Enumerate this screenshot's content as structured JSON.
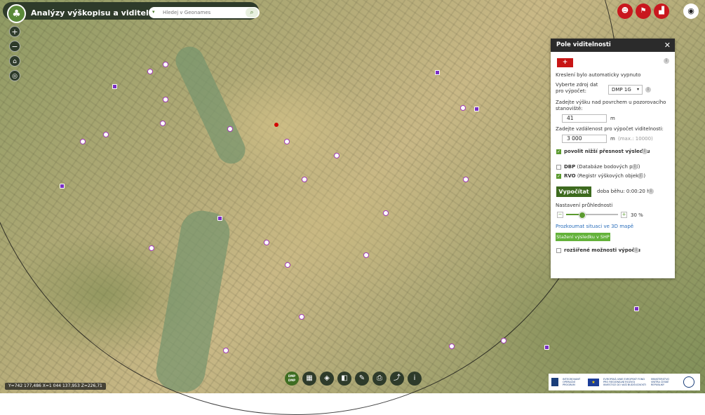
{
  "app": {
    "title": "Analýzy výškopisu a viditelnosti",
    "logo_icon": "tree-icon"
  },
  "search": {
    "placeholder": "Hledej v Geonames"
  },
  "panel": {
    "title": "Pole viditelnosti",
    "draw_button": "+",
    "auto_note": "Kreslení bylo automaticky vypnuto",
    "source_label": "Vyberte zdroj dat pro výpočet:",
    "source_value": "DMP 1G",
    "height_label": "Zadejte výšku nad povrchem u pozorovacího stanoviště:",
    "height_value": "41",
    "height_unit": "m",
    "distance_label": "Zadejte vzdálenost pro výpočet viditelnosti:",
    "distance_value": "3 000",
    "distance_unit": "m",
    "distance_max": "(max.: 10000)",
    "low_precision": "povolit nižší přesnost výsledku",
    "dbp_bold": "DBP",
    "dbp_rest": "(Databáze bodových polí)",
    "rvo_bold": "RVO",
    "rvo_rest": "(Registr výškových objektů)",
    "compute_button": "Vypočítat",
    "runtime": "doba běhu: 0:00:20 h",
    "transparency_label": "Nastavení průhlednosti",
    "transparency_value": 30,
    "transparency_text": "30 %",
    "explore_3d": "Prozkoumat situaci ve 3D mapě",
    "download_shp": "Stažení výsledku v SHP",
    "advanced": "rozšířené možnosti výpočtu"
  },
  "toolbar": {
    "dmp_line1": "DMP",
    "dmp_line2": "DMP"
  },
  "status": {
    "coords": "Y=742 177,486  X=1 044 137,953  Z=226,71"
  },
  "logos": {
    "op": "INTEGROVANÝ OPERAČNÍ PROGRAM",
    "eu": "EVROPSKÁ UNIE EVROPSKÝ FOND PRO REGIONÁLNÍ ROZVOJ INVESTICE DO VAŠÍ BUDOUCNOSTI",
    "ministry": "MINISTERSTVO VNITRA ČESKÉ REPUBLIKY"
  },
  "colors": {
    "header": "#2e3b2a",
    "accent_red": "#c9171e",
    "compute_green": "#3d6a1e",
    "download_green": "#63b23a"
  }
}
